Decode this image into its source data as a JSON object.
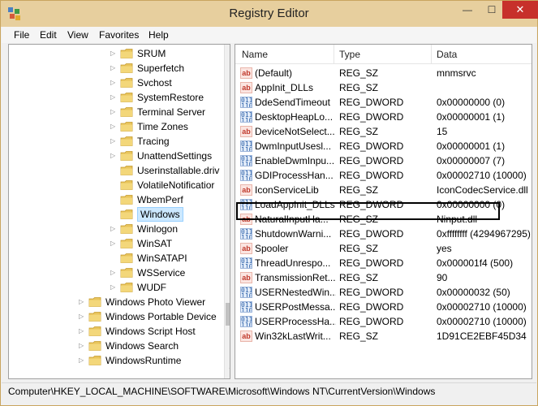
{
  "window": {
    "title": "Registry Editor",
    "controls": {
      "minimize": "—",
      "maximize": "☐",
      "close": "✕"
    }
  },
  "menu": [
    "File",
    "Edit",
    "View",
    "Favorites",
    "Help"
  ],
  "tree": [
    {
      "label": "SRUM",
      "level": 1,
      "expandable": true
    },
    {
      "label": "Superfetch",
      "level": 1,
      "expandable": true
    },
    {
      "label": "Svchost",
      "level": 1,
      "expandable": true
    },
    {
      "label": "SystemRestore",
      "level": 1,
      "expandable": true
    },
    {
      "label": "Terminal Server",
      "level": 1,
      "expandable": true
    },
    {
      "label": "Time Zones",
      "level": 1,
      "expandable": true
    },
    {
      "label": "Tracing",
      "level": 1,
      "expandable": true
    },
    {
      "label": "UnattendSettings",
      "level": 1,
      "expandable": true
    },
    {
      "label": "Userinstallable.driv",
      "level": 1,
      "expandable": false
    },
    {
      "label": "VolatileNotificatior",
      "level": 1,
      "expandable": false
    },
    {
      "label": "WbemPerf",
      "level": 1,
      "expandable": false
    },
    {
      "label": "Windows",
      "level": 1,
      "expandable": false,
      "selected": true
    },
    {
      "label": "Winlogon",
      "level": 1,
      "expandable": true
    },
    {
      "label": "WinSAT",
      "level": 1,
      "expandable": true
    },
    {
      "label": "WinSATAPI",
      "level": 1,
      "expandable": false
    },
    {
      "label": "WSService",
      "level": 1,
      "expandable": true
    },
    {
      "label": "WUDF",
      "level": 1,
      "expandable": true
    },
    {
      "label": "Windows Photo Viewer",
      "level": 0,
      "expandable": true
    },
    {
      "label": "Windows Portable Device",
      "level": 0,
      "expandable": true
    },
    {
      "label": "Windows Script Host",
      "level": 0,
      "expandable": true
    },
    {
      "label": "Windows Search",
      "level": 0,
      "expandable": true
    },
    {
      "label": "WindowsRuntime",
      "level": 0,
      "expandable": true
    }
  ],
  "columns": {
    "name": "Name",
    "type": "Type",
    "data": "Data"
  },
  "values": [
    {
      "name": "(Default)",
      "type": "REG_SZ",
      "data": "mnmsrvc",
      "kind": "sz"
    },
    {
      "name": "AppInit_DLLs",
      "type": "REG_SZ",
      "data": "",
      "kind": "sz"
    },
    {
      "name": "DdeSendTimeout",
      "type": "REG_DWORD",
      "data": "0x00000000 (0)",
      "kind": "dw"
    },
    {
      "name": "DesktopHeapLo...",
      "type": "REG_DWORD",
      "data": "0x00000001 (1)",
      "kind": "dw"
    },
    {
      "name": "DeviceNotSelect...",
      "type": "REG_SZ",
      "data": "15",
      "kind": "sz"
    },
    {
      "name": "DwmInputUsesl...",
      "type": "REG_DWORD",
      "data": "0x00000001 (1)",
      "kind": "dw"
    },
    {
      "name": "EnableDwmInpu...",
      "type": "REG_DWORD",
      "data": "0x00000007 (7)",
      "kind": "dw"
    },
    {
      "name": "GDIProcessHan...",
      "type": "REG_DWORD",
      "data": "0x00002710 (10000)",
      "kind": "dw"
    },
    {
      "name": "IconServiceLib",
      "type": "REG_SZ",
      "data": "IconCodecService.dll",
      "kind": "sz"
    },
    {
      "name": "LoadAppInit_DLLs",
      "type": "REG_DWORD",
      "data": "0x00000000 (0)",
      "kind": "dw",
      "highlighted": true
    },
    {
      "name": "NaturalInputHa...",
      "type": "REG_SZ",
      "data": "Ninput.dll",
      "kind": "sz"
    },
    {
      "name": "ShutdownWarni...",
      "type": "REG_DWORD",
      "data": "0xffffffff (4294967295)",
      "kind": "dw"
    },
    {
      "name": "Spooler",
      "type": "REG_SZ",
      "data": "yes",
      "kind": "sz"
    },
    {
      "name": "ThreadUnrespo...",
      "type": "REG_DWORD",
      "data": "0x000001f4 (500)",
      "kind": "dw"
    },
    {
      "name": "TransmissionRet...",
      "type": "REG_SZ",
      "data": "90",
      "kind": "sz"
    },
    {
      "name": "USERNestedWin...",
      "type": "REG_DWORD",
      "data": "0x00000032 (50)",
      "kind": "dw"
    },
    {
      "name": "USERPostMessa...",
      "type": "REG_DWORD",
      "data": "0x00002710 (10000)",
      "kind": "dw"
    },
    {
      "name": "USERProcessHa...",
      "type": "REG_DWORD",
      "data": "0x00002710 (10000)",
      "kind": "dw"
    },
    {
      "name": "Win32kLastWrit...",
      "type": "REG_SZ",
      "data": "1D91CE2EBF45D34",
      "kind": "sz"
    }
  ],
  "status": "Computer\\HKEY_LOCAL_MACHINE\\SOFTWARE\\Microsoft\\Windows NT\\CurrentVersion\\Windows",
  "icons": {
    "sz": "ab",
    "dw": "011\n110"
  },
  "colors": {
    "titlebar": "#e7cf9e",
    "close": "#c7302b",
    "selection": "#cce8ff",
    "folder": "#e8c45c"
  }
}
